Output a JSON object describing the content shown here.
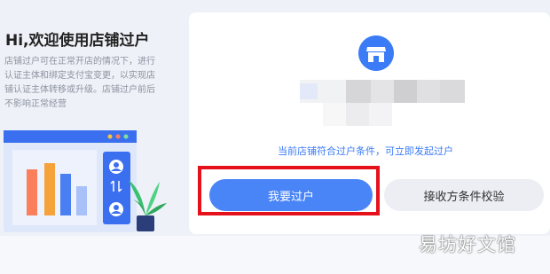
{
  "intro": {
    "title": "Hi,欢迎使用店铺过户",
    "description": "店铺过户可在正常开店的情况下，进行认证主体和绑定支付宝变更，以实现店铺认证主体转移或升级。店铺过户前后不影响正常经营"
  },
  "status": {
    "hint": "当前店铺符合过户条件，可立即发起过户"
  },
  "actions": {
    "primary_label": "我要过户",
    "secondary_label": "接收方条件校验"
  },
  "watermark": "易坊好文馆",
  "colors": {
    "accent": "#3b7bf6",
    "highlight": "#e5121b"
  },
  "icons": [
    "store-icon",
    "user-icon",
    "transfer-arrows-icon",
    "plant-icon"
  ]
}
